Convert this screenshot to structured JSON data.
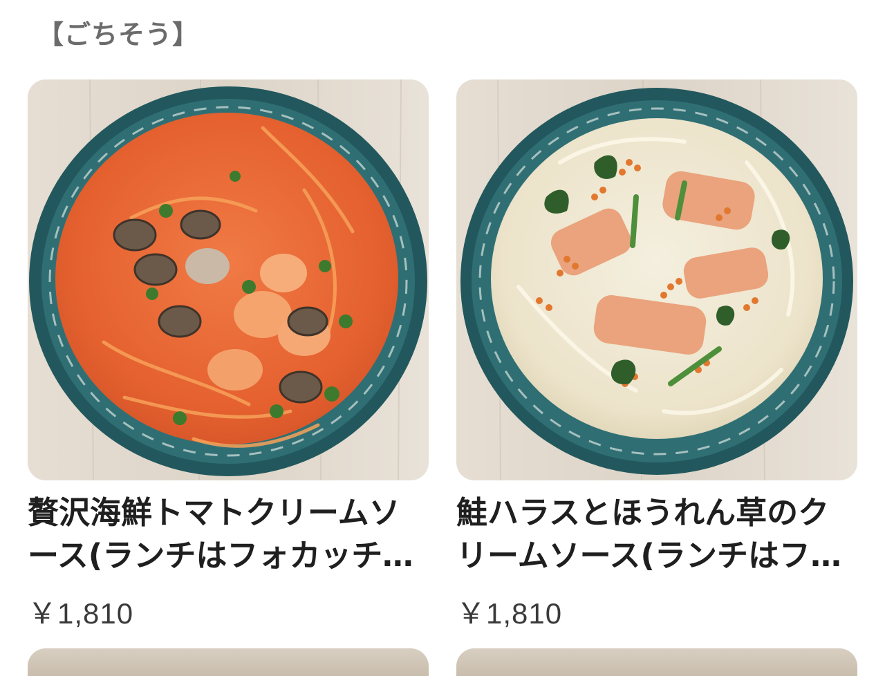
{
  "section": {
    "heading": "【ごちそう】"
  },
  "items": [
    {
      "title": "贅沢海鮮トマトクリームソース(ランチはフォカッチャ付き)",
      "price": "￥1,810",
      "image": "tomato-cream-seafood-pasta-photo"
    },
    {
      "title": "鮭ハラスとほうれん草のクリームソース(ランチはフォカッチャ付き)",
      "price": "￥1,810",
      "image": "salmon-spinach-cream-pasta-photo"
    }
  ],
  "colors": {
    "plate_teal": "#2f6f74",
    "tomato_sauce": "#e8673a",
    "cream_sauce": "#efe8d4",
    "wood_background": "#e4ddd2",
    "heading_gray": "#6b6b6b"
  }
}
